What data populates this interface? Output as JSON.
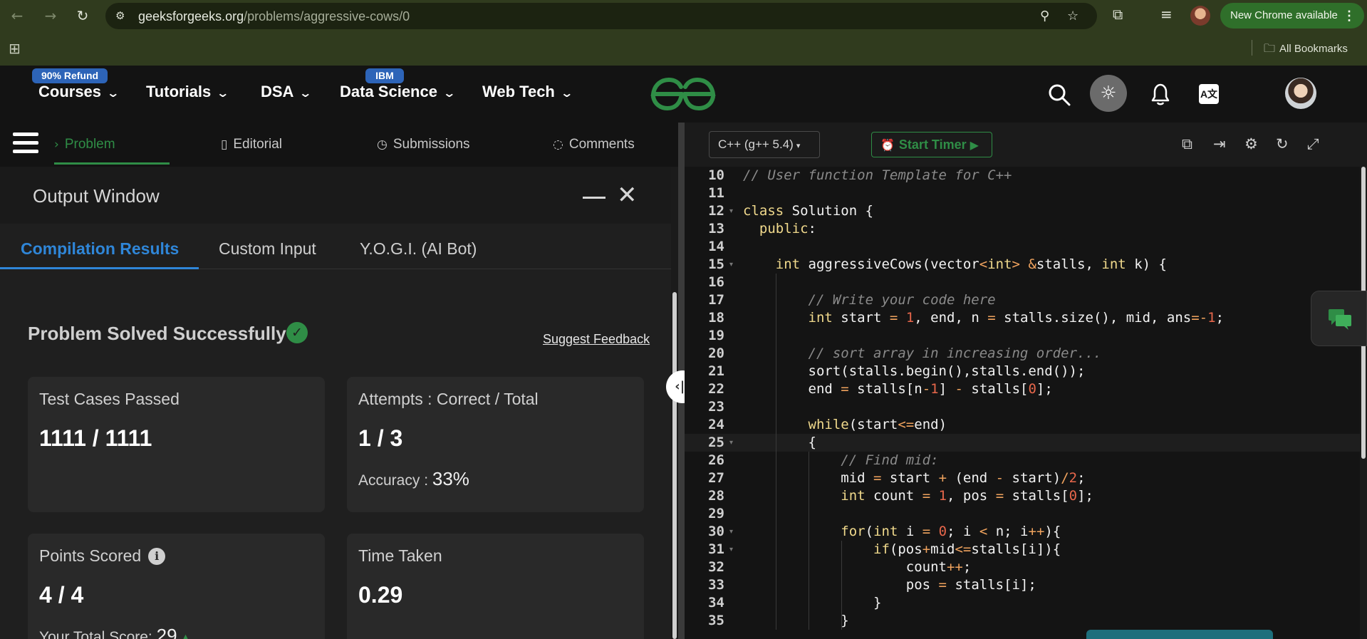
{
  "browser": {
    "url_host": "geeksforgeeks.org",
    "url_path": "/problems/aggressive-cows/0",
    "new_chrome_label": "New Chrome available",
    "all_bookmarks": "All Bookmarks"
  },
  "nav": {
    "items": [
      {
        "label": "Courses",
        "badge": "90% Refund"
      },
      {
        "label": "Tutorials"
      },
      {
        "label": "DSA"
      },
      {
        "label": "Data Science",
        "badge": "IBM"
      },
      {
        "label": "Web Tech"
      }
    ],
    "brand_color": "#2f8d46"
  },
  "problem_tabs": [
    {
      "label": "Problem",
      "icon": "problem-icon"
    },
    {
      "label": "Editorial",
      "icon": "document-icon"
    },
    {
      "label": "Submissions",
      "icon": "clock-icon"
    },
    {
      "label": "Comments",
      "icon": "comment-icon"
    }
  ],
  "output": {
    "title": "Output Window",
    "tabs": [
      "Compilation Results",
      "Custom Input",
      "Y.O.G.I. (AI Bot)"
    ],
    "status": "Problem Solved Successfully",
    "feedback": "Suggest Feedback",
    "cards": {
      "tests": {
        "label": "Test Cases Passed",
        "value": "1111 / 1111"
      },
      "attempts": {
        "label": "Attempts : Correct / Total",
        "value": "1 / 3",
        "accuracy_label": "Accuracy :",
        "accuracy_value": "33%"
      },
      "points": {
        "label": "Points Scored",
        "value": "4 / 4",
        "total_label": "Your Total Score:",
        "total_value": "29"
      },
      "time": {
        "label": "Time Taken",
        "value": "0.29"
      }
    }
  },
  "editor": {
    "language": "C++ (g++ 5.4)",
    "timer_label": "Start Timer",
    "lines": [
      {
        "n": "10",
        "html": "<span class='cm'>// User function Template for C++</span>"
      },
      {
        "n": "11",
        "html": ""
      },
      {
        "n": "12",
        "fold": true,
        "html": "<span class='kw'>class</span> Solution {"
      },
      {
        "n": "13",
        "html": "  <span class='kw'>public</span>:"
      },
      {
        "n": "14",
        "html": ""
      },
      {
        "n": "15",
        "fold": true,
        "html": "    <span class='ty'>int</span> aggressiveCows(vector<span class='op'>&lt;</span><span class='ty'>int</span><span class='op'>&gt;</span> <span class='op'>&amp;</span>stalls, <span class='ty'>int</span> k) {"
      },
      {
        "n": "16",
        "html": ""
      },
      {
        "n": "17",
        "html": "        <span class='cm'>// Write your code here</span>"
      },
      {
        "n": "18",
        "html": "        <span class='ty'>int</span> start <span class='op'>=</span> <span class='nm'>1</span>, end, n <span class='op'>=</span> stalls.size(), mid, ans<span class='op'>=-</span><span class='nm'>1</span>;"
      },
      {
        "n": "19",
        "html": ""
      },
      {
        "n": "20",
        "html": "        <span class='cm'>// sort array in increasing order...</span>"
      },
      {
        "n": "21",
        "html": "        sort(stalls.begin(),stalls.end());"
      },
      {
        "n": "22",
        "html": "        end <span class='op'>=</span> stalls[n<span class='op'>-</span><span class='nm'>1</span>] <span class='op'>-</span> stalls[<span class='nm'>0</span>];"
      },
      {
        "n": "23",
        "html": ""
      },
      {
        "n": "24",
        "html": "        <span class='kw'>while</span>(start<span class='op'>&lt;=</span>end)"
      },
      {
        "n": "25",
        "fold": true,
        "active": true,
        "html": "        {"
      },
      {
        "n": "26",
        "html": "            <span class='cm'>// Find mid:</span>"
      },
      {
        "n": "27",
        "html": "            mid <span class='op'>=</span> start <span class='op'>+</span> (end <span class='op'>-</span> start)<span class='op'>/</span><span class='nm'>2</span>;"
      },
      {
        "n": "28",
        "html": "            <span class='ty'>int</span> count <span class='op'>=</span> <span class='nm'>1</span>, pos <span class='op'>=</span> stalls[<span class='nm'>0</span>];"
      },
      {
        "n": "29",
        "html": ""
      },
      {
        "n": "30",
        "fold": true,
        "html": "            <span class='kw'>for</span>(<span class='ty'>int</span> i <span class='op'>=</span> <span class='nm'>0</span>; i <span class='op'>&lt;</span> n; i<span class='op'>++</span>){"
      },
      {
        "n": "31",
        "fold": true,
        "html": "                <span class='kw'>if</span>(pos<span class='op'>+</span>mid<span class='op'>&lt;=</span>stalls[i]){"
      },
      {
        "n": "32",
        "html": "                    count<span class='op'>++</span>;"
      },
      {
        "n": "33",
        "html": "                    pos <span class='op'>=</span> stalls[i];"
      },
      {
        "n": "34",
        "html": "                }"
      },
      {
        "n": "35",
        "html": "            }"
      }
    ]
  }
}
